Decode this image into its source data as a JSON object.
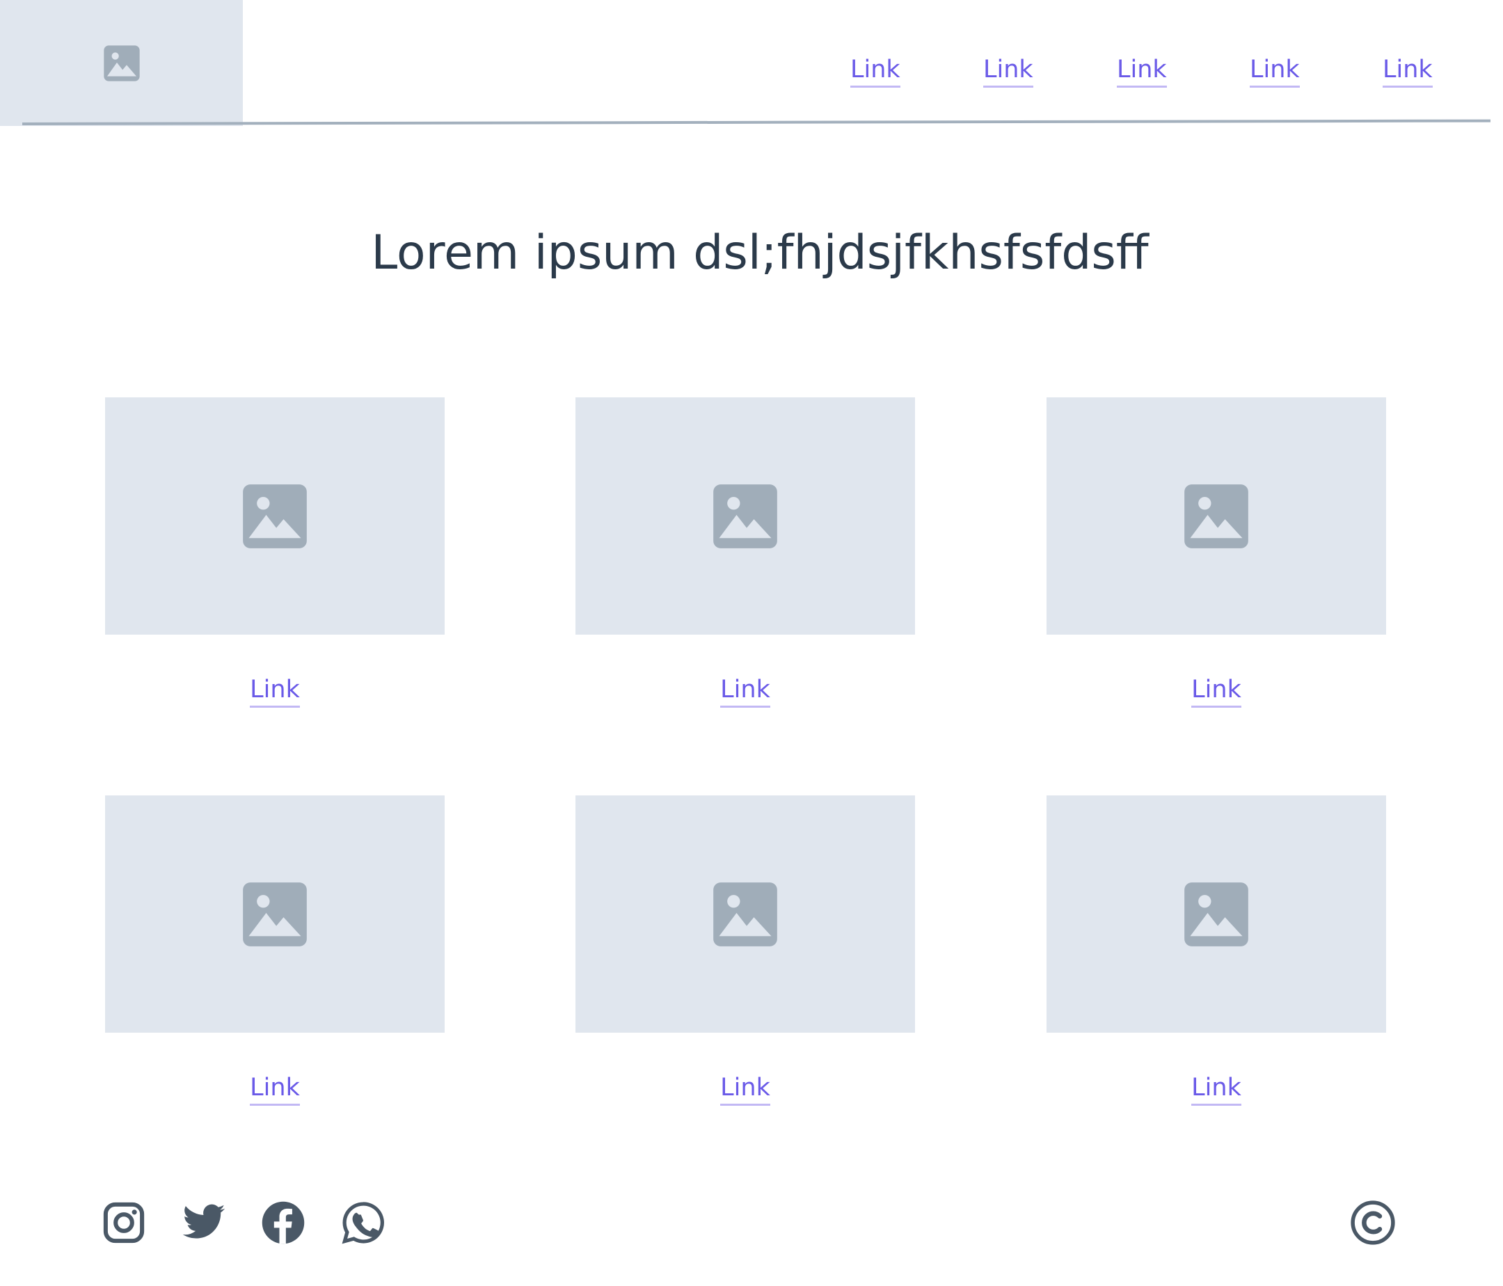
{
  "header": {
    "logo_icon": "image-placeholder-icon",
    "nav": [
      {
        "label": "Link"
      },
      {
        "label": "Link"
      },
      {
        "label": "Link"
      },
      {
        "label": "Link"
      },
      {
        "label": "Link"
      }
    ]
  },
  "main": {
    "title": "Lorem ipsum dsl;fhjdsjfkhsfsfdsff",
    "cards": [
      {
        "image_icon": "image-placeholder-icon",
        "link": "Link"
      },
      {
        "image_icon": "image-placeholder-icon",
        "link": "Link"
      },
      {
        "image_icon": "image-placeholder-icon",
        "link": "Link"
      },
      {
        "image_icon": "image-placeholder-icon",
        "link": "Link"
      },
      {
        "image_icon": "image-placeholder-icon",
        "link": "Link"
      },
      {
        "image_icon": "image-placeholder-icon",
        "link": "Link"
      }
    ]
  },
  "footer": {
    "social": [
      "instagram-icon",
      "twitter-icon",
      "facebook-icon",
      "whatsapp-icon"
    ],
    "copyright_icon": "copyright-icon"
  },
  "colors": {
    "link": "#6a5ae8",
    "link_underline": "#c2b8f4",
    "placeholder_bg": "#e0e6ee",
    "placeholder_icon": "#a0adb9",
    "text_dark": "#2b3a4a",
    "icon_dark": "#4a5866",
    "divider": "#a3b0bd"
  }
}
